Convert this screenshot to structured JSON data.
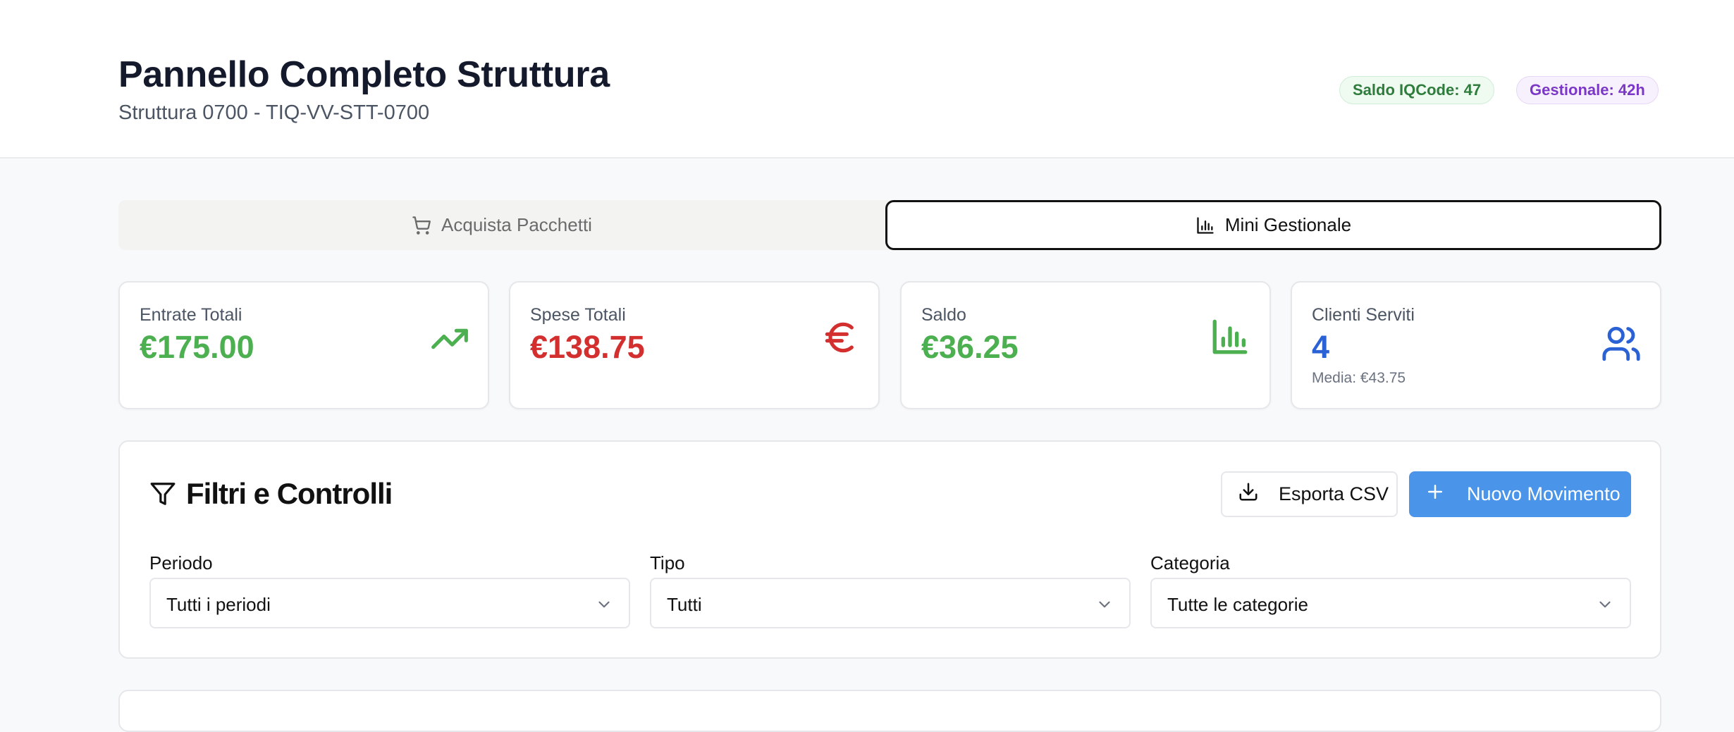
{
  "header": {
    "title": "Pannello Completo Struttura",
    "subtitle": "Struttura 0700 - TIQ-VV-STT-0700",
    "badges": {
      "iqcode": "Saldo IQCode: 47",
      "gestionale": "Gestionale: 42h"
    }
  },
  "tabs": [
    {
      "label": "Acquista Pacchetti",
      "icon": "shopping-cart-icon",
      "active": false
    },
    {
      "label": "Mini Gestionale",
      "icon": "bar-chart-icon",
      "active": true
    }
  ],
  "stats": [
    {
      "label": "Entrate Totali",
      "value": "€175.00",
      "icon": "trending-up-icon",
      "color": "#4caf50"
    },
    {
      "label": "Spese Totali",
      "value": "€138.75",
      "icon": "euro-icon",
      "color": "#d32f2f"
    },
    {
      "label": "Saldo",
      "value": "€36.25",
      "icon": "bar-chart-icon",
      "color": "#4caf50"
    },
    {
      "label": "Clienti Serviti",
      "value": "4",
      "sub": "Media: €43.75",
      "icon": "users-icon",
      "color": "#2a62d6"
    }
  ],
  "filters": {
    "title": "Filtri e Controlli",
    "export_label": "Esporta CSV",
    "new_label": "Nuovo Movimento",
    "fields": [
      {
        "label": "Periodo",
        "value": "Tutti i periodi"
      },
      {
        "label": "Tipo",
        "value": "Tutti"
      },
      {
        "label": "Categoria",
        "value": "Tutte le categorie"
      }
    ]
  },
  "colors": {
    "accent_blue": "#4a95ea",
    "positive_green": "#4caf50",
    "negative_red": "#d32f2f",
    "info_blue": "#2a62d6"
  }
}
